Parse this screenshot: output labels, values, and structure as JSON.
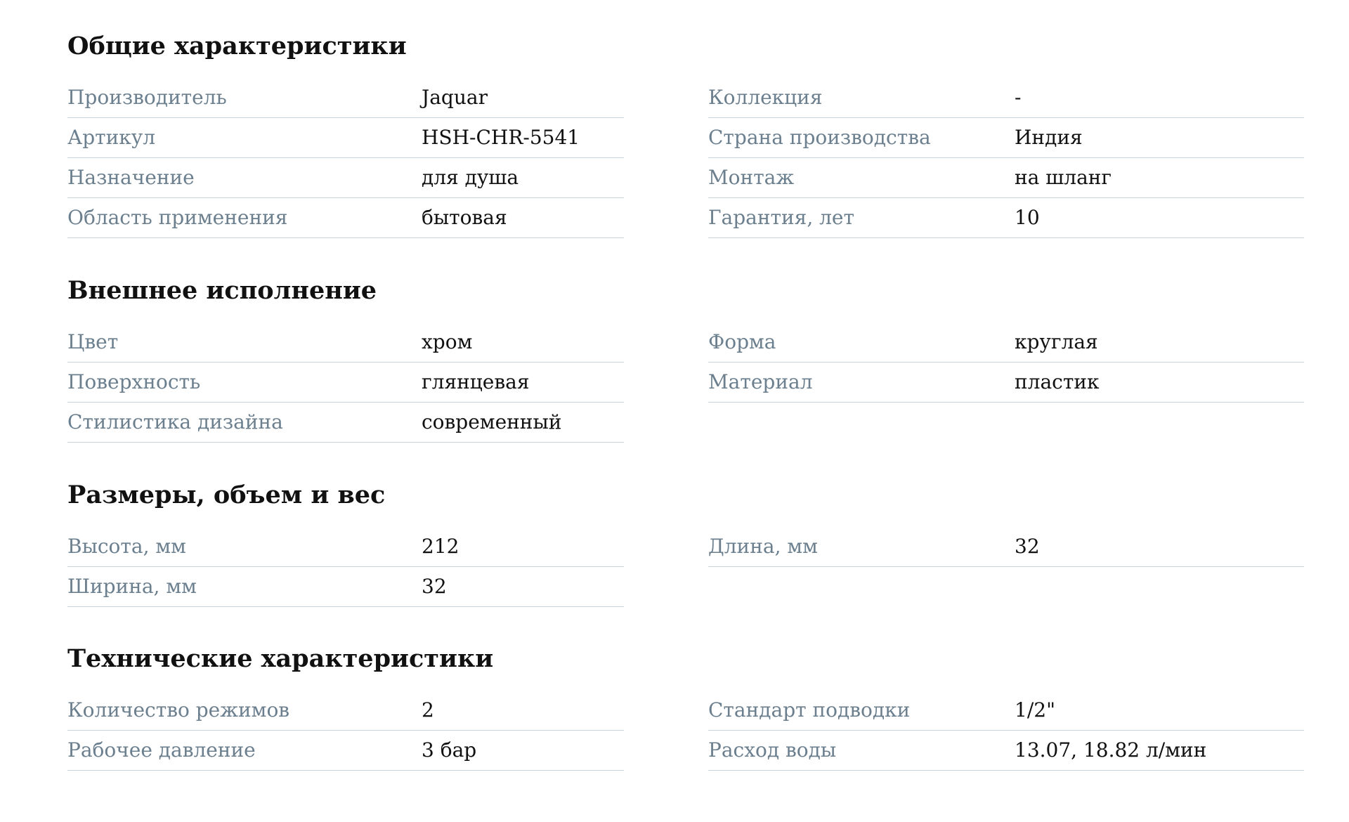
{
  "sections": [
    {
      "title": "Общие характеристики",
      "left": [
        {
          "label": "Производитель",
          "value": "Jaquar"
        },
        {
          "label": "Артикул",
          "value": "HSH-CHR-5541"
        },
        {
          "label": "Назначение",
          "value": "для душа"
        },
        {
          "label": "Область применения",
          "value": "бытовая"
        }
      ],
      "right": [
        {
          "label": "Коллекция",
          "value": "-"
        },
        {
          "label": "Страна производства",
          "value": "Индия"
        },
        {
          "label": "Монтаж",
          "value": "на шланг"
        },
        {
          "label": "Гарантия, лет",
          "value": "10"
        }
      ]
    },
    {
      "title": "Внешнее исполнение",
      "left": [
        {
          "label": "Цвет",
          "value": "хром"
        },
        {
          "label": "Поверхность",
          "value": "глянцевая"
        },
        {
          "label": "Стилистика дизайна",
          "value": "современный"
        }
      ],
      "right": [
        {
          "label": "Форма",
          "value": "круглая"
        },
        {
          "label": "Материал",
          "value": "пластик"
        }
      ]
    },
    {
      "title": "Размеры, объем и вес",
      "left": [
        {
          "label": "Высота, мм",
          "value": "212"
        },
        {
          "label": "Ширина, мм",
          "value": "32"
        }
      ],
      "right": [
        {
          "label": "Длина, мм",
          "value": "32"
        }
      ]
    },
    {
      "title": "Технические характеристики",
      "left": [
        {
          "label": "Количество режимов",
          "value": "2"
        },
        {
          "label": "Рабочее давление",
          "value": "3 бар"
        }
      ],
      "right": [
        {
          "label": "Стандарт подводки",
          "value": "1/2\""
        },
        {
          "label": "Расход воды",
          "value": "13.07, 18.82 л/мин"
        }
      ]
    }
  ]
}
